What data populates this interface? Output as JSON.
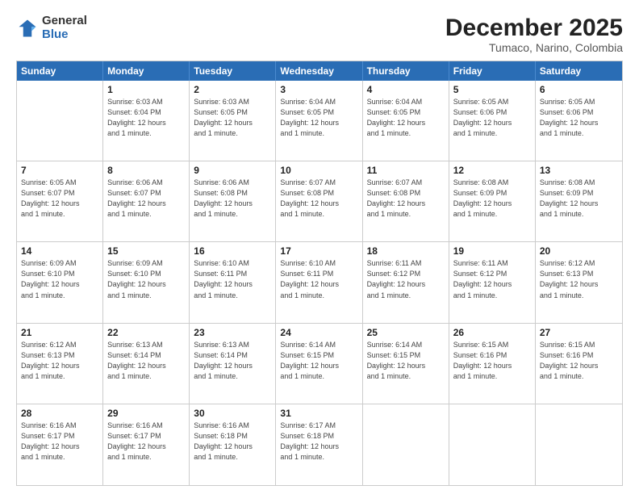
{
  "logo": {
    "general": "General",
    "blue": "Blue"
  },
  "title": "December 2025",
  "location": "Tumaco, Narino, Colombia",
  "header_days": [
    "Sunday",
    "Monday",
    "Tuesday",
    "Wednesday",
    "Thursday",
    "Friday",
    "Saturday"
  ],
  "weeks": [
    [
      {
        "day": "",
        "info": ""
      },
      {
        "day": "1",
        "info": "Sunrise: 6:03 AM\nSunset: 6:04 PM\nDaylight: 12 hours\nand 1 minute."
      },
      {
        "day": "2",
        "info": "Sunrise: 6:03 AM\nSunset: 6:05 PM\nDaylight: 12 hours\nand 1 minute."
      },
      {
        "day": "3",
        "info": "Sunrise: 6:04 AM\nSunset: 6:05 PM\nDaylight: 12 hours\nand 1 minute."
      },
      {
        "day": "4",
        "info": "Sunrise: 6:04 AM\nSunset: 6:05 PM\nDaylight: 12 hours\nand 1 minute."
      },
      {
        "day": "5",
        "info": "Sunrise: 6:05 AM\nSunset: 6:06 PM\nDaylight: 12 hours\nand 1 minute."
      },
      {
        "day": "6",
        "info": "Sunrise: 6:05 AM\nSunset: 6:06 PM\nDaylight: 12 hours\nand 1 minute."
      }
    ],
    [
      {
        "day": "7",
        "info": "Sunrise: 6:05 AM\nSunset: 6:07 PM\nDaylight: 12 hours\nand 1 minute."
      },
      {
        "day": "8",
        "info": "Sunrise: 6:06 AM\nSunset: 6:07 PM\nDaylight: 12 hours\nand 1 minute."
      },
      {
        "day": "9",
        "info": "Sunrise: 6:06 AM\nSunset: 6:08 PM\nDaylight: 12 hours\nand 1 minute."
      },
      {
        "day": "10",
        "info": "Sunrise: 6:07 AM\nSunset: 6:08 PM\nDaylight: 12 hours\nand 1 minute."
      },
      {
        "day": "11",
        "info": "Sunrise: 6:07 AM\nSunset: 6:08 PM\nDaylight: 12 hours\nand 1 minute."
      },
      {
        "day": "12",
        "info": "Sunrise: 6:08 AM\nSunset: 6:09 PM\nDaylight: 12 hours\nand 1 minute."
      },
      {
        "day": "13",
        "info": "Sunrise: 6:08 AM\nSunset: 6:09 PM\nDaylight: 12 hours\nand 1 minute."
      }
    ],
    [
      {
        "day": "14",
        "info": "Sunrise: 6:09 AM\nSunset: 6:10 PM\nDaylight: 12 hours\nand 1 minute."
      },
      {
        "day": "15",
        "info": "Sunrise: 6:09 AM\nSunset: 6:10 PM\nDaylight: 12 hours\nand 1 minute."
      },
      {
        "day": "16",
        "info": "Sunrise: 6:10 AM\nSunset: 6:11 PM\nDaylight: 12 hours\nand 1 minute."
      },
      {
        "day": "17",
        "info": "Sunrise: 6:10 AM\nSunset: 6:11 PM\nDaylight: 12 hours\nand 1 minute."
      },
      {
        "day": "18",
        "info": "Sunrise: 6:11 AM\nSunset: 6:12 PM\nDaylight: 12 hours\nand 1 minute."
      },
      {
        "day": "19",
        "info": "Sunrise: 6:11 AM\nSunset: 6:12 PM\nDaylight: 12 hours\nand 1 minute."
      },
      {
        "day": "20",
        "info": "Sunrise: 6:12 AM\nSunset: 6:13 PM\nDaylight: 12 hours\nand 1 minute."
      }
    ],
    [
      {
        "day": "21",
        "info": "Sunrise: 6:12 AM\nSunset: 6:13 PM\nDaylight: 12 hours\nand 1 minute."
      },
      {
        "day": "22",
        "info": "Sunrise: 6:13 AM\nSunset: 6:14 PM\nDaylight: 12 hours\nand 1 minute."
      },
      {
        "day": "23",
        "info": "Sunrise: 6:13 AM\nSunset: 6:14 PM\nDaylight: 12 hours\nand 1 minute."
      },
      {
        "day": "24",
        "info": "Sunrise: 6:14 AM\nSunset: 6:15 PM\nDaylight: 12 hours\nand 1 minute."
      },
      {
        "day": "25",
        "info": "Sunrise: 6:14 AM\nSunset: 6:15 PM\nDaylight: 12 hours\nand 1 minute."
      },
      {
        "day": "26",
        "info": "Sunrise: 6:15 AM\nSunset: 6:16 PM\nDaylight: 12 hours\nand 1 minute."
      },
      {
        "day": "27",
        "info": "Sunrise: 6:15 AM\nSunset: 6:16 PM\nDaylight: 12 hours\nand 1 minute."
      }
    ],
    [
      {
        "day": "28",
        "info": "Sunrise: 6:16 AM\nSunset: 6:17 PM\nDaylight: 12 hours\nand 1 minute."
      },
      {
        "day": "29",
        "info": "Sunrise: 6:16 AM\nSunset: 6:17 PM\nDaylight: 12 hours\nand 1 minute."
      },
      {
        "day": "30",
        "info": "Sunrise: 6:16 AM\nSunset: 6:18 PM\nDaylight: 12 hours\nand 1 minute."
      },
      {
        "day": "31",
        "info": "Sunrise: 6:17 AM\nSunset: 6:18 PM\nDaylight: 12 hours\nand 1 minute."
      },
      {
        "day": "",
        "info": ""
      },
      {
        "day": "",
        "info": ""
      },
      {
        "day": "",
        "info": ""
      }
    ]
  ]
}
